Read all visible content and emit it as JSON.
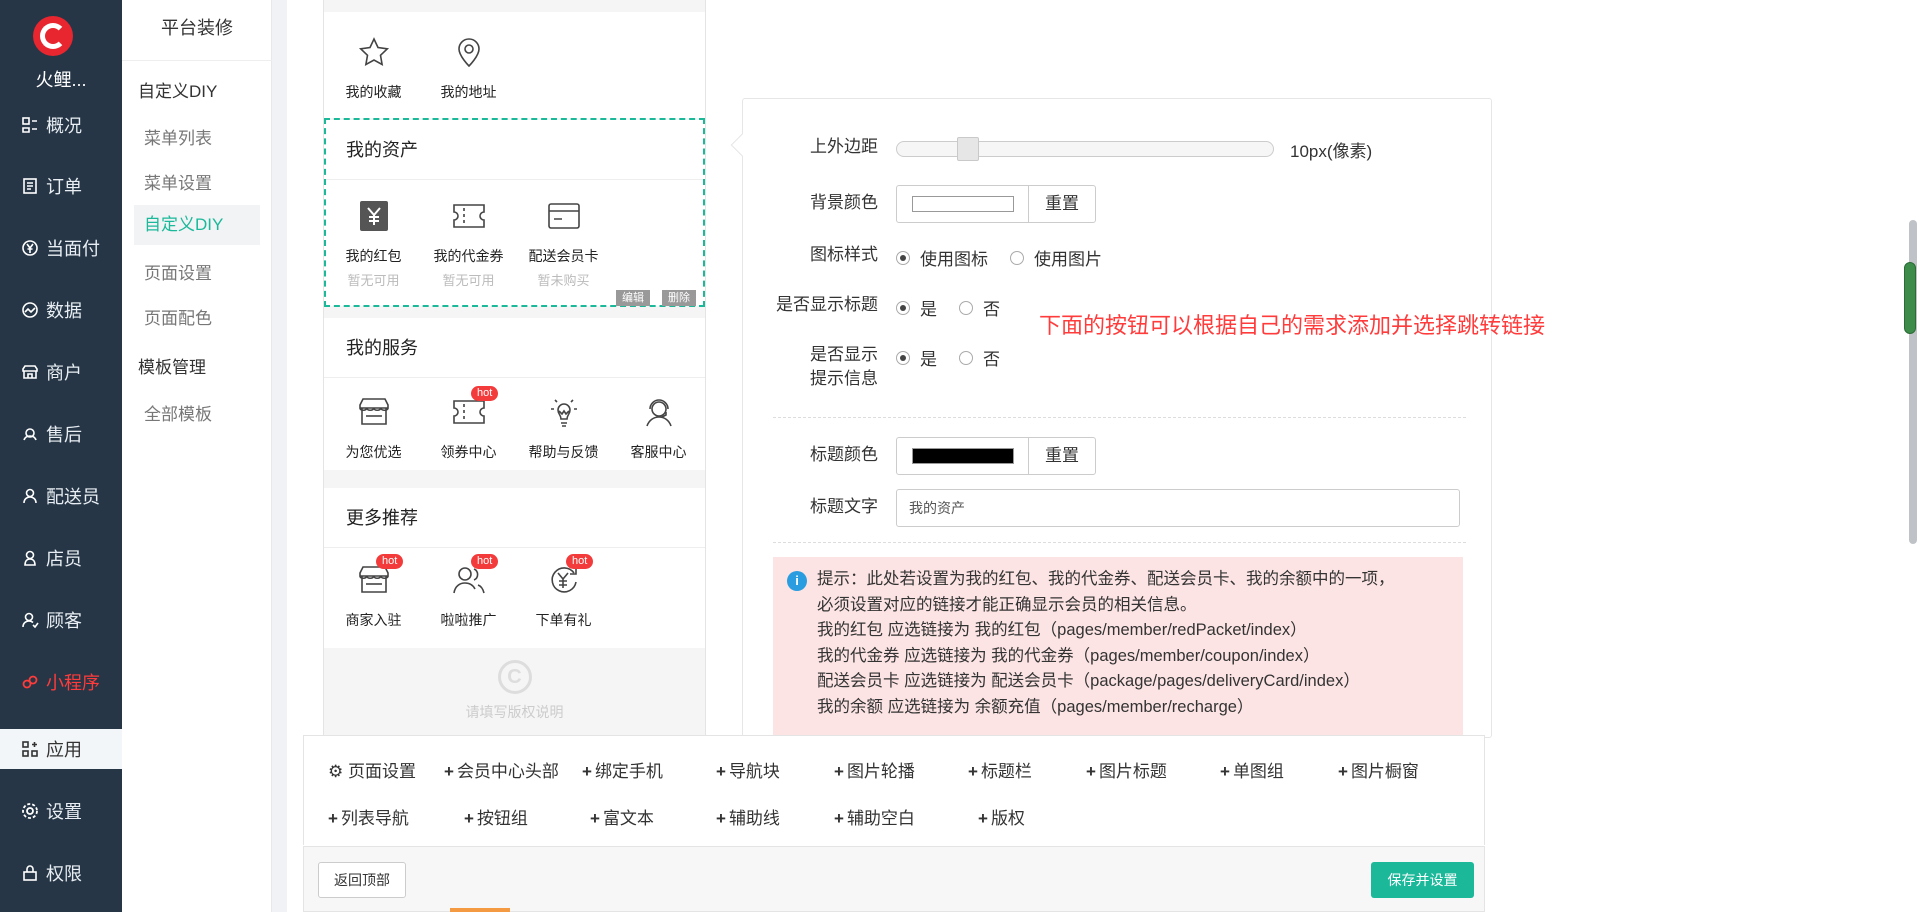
{
  "nav": {
    "brand": "火鲤...",
    "items": [
      {
        "label": "概况",
        "icon": "dashboard-icon"
      },
      {
        "label": "订单",
        "icon": "order-icon"
      },
      {
        "label": "当面付",
        "icon": "yen-circle-icon"
      },
      {
        "label": "数据",
        "icon": "chart-icon"
      },
      {
        "label": "商户",
        "icon": "store-icon"
      },
      {
        "label": "售后",
        "icon": "headset-icon"
      },
      {
        "label": "配送员",
        "icon": "courier-icon"
      },
      {
        "label": "店员",
        "icon": "clerk-icon"
      },
      {
        "label": "顾客",
        "icon": "customer-icon"
      },
      {
        "label": "小程序",
        "icon": "miniapp-icon"
      },
      {
        "label": "应用",
        "icon": "apps-icon"
      },
      {
        "label": "设置",
        "icon": "gear-icon"
      },
      {
        "label": "权限",
        "icon": "lock-icon"
      }
    ]
  },
  "submenu": {
    "title": "平台装修",
    "group1": "自定义DIY",
    "items1": [
      "菜单列表",
      "菜单设置",
      "自定义DIY",
      "页面设置",
      "页面配色"
    ],
    "group2": "模板管理",
    "items2": [
      "全部模板"
    ]
  },
  "phone": {
    "top_items": [
      "我的收藏",
      "我的地址"
    ],
    "assets": {
      "title": "我的资产",
      "items": [
        {
          "label": "我的红包",
          "sub": "暂无可用"
        },
        {
          "label": "我的代金券",
          "sub": "暂无可用"
        },
        {
          "label": "配送会员卡",
          "sub": "暂未购买"
        }
      ],
      "edit": "编辑",
      "delete": "删除"
    },
    "services": {
      "title": "我的服务",
      "items": [
        "为您优选",
        "领券中心",
        "帮助与反馈",
        "客服中心"
      ]
    },
    "more": {
      "title": "更多推荐",
      "items": [
        "商家入驻",
        "啦啦推广",
        "下单有礼"
      ]
    },
    "hot": "hot",
    "copyright_placeholder": "请填写版权说明"
  },
  "settings": {
    "margin_label": "上外边距",
    "margin_percent": 16,
    "margin_value": "10px(像素)",
    "bg_color_label": "背景颜色",
    "bg_color": "#ffffff",
    "reset": "重置",
    "icon_style_label": "图标样式",
    "icon_style_options": [
      "使用图标",
      "使用图片"
    ],
    "show_title_label": "是否显示标题",
    "yes": "是",
    "no": "否",
    "show_tip_label_1": "是否显示",
    "show_tip_label_2": "提示信息",
    "title_color_label": "标题颜色",
    "title_color": "#000000",
    "title_text_label": "标题文字",
    "title_text": "我的资产",
    "tip_lines": [
      "提示：此处若设置为我的红包、我的代金券、配送会员卡、我的余额中的一项，",
      "必须设置对应的链接才能正确显示会员的相关信息。",
      "我的红包 应选链接为 我的红包（pages/member/redPacket/index）",
      "我的代金券 应选链接为 我的代金券（pages/member/coupon/index）",
      "配送会员卡 应选链接为 配送会员卡（package/pages/deliveryCard/index）",
      "我的余额 应选链接为 余额充值（pages/member/recharge）"
    ]
  },
  "annotation": "下面的按钮可以根据自己的需求添加并选择跳转链接",
  "components": {
    "row1": [
      "页面设置",
      "会员中心头部",
      "绑定手机",
      "导航块",
      "图片轮播",
      "标题栏",
      "图片标题",
      "单图组",
      "图片橱窗"
    ],
    "row2": [
      "列表导航",
      "按钮组",
      "富文本",
      "辅助线",
      "辅助空白",
      "版权"
    ]
  },
  "footer": {
    "back_top": "返回顶部",
    "save": "保存并设置"
  },
  "colors": {
    "accent": "#1bb99a",
    "nav_bg": "#263646",
    "alert_red": "#ff3b3b"
  }
}
